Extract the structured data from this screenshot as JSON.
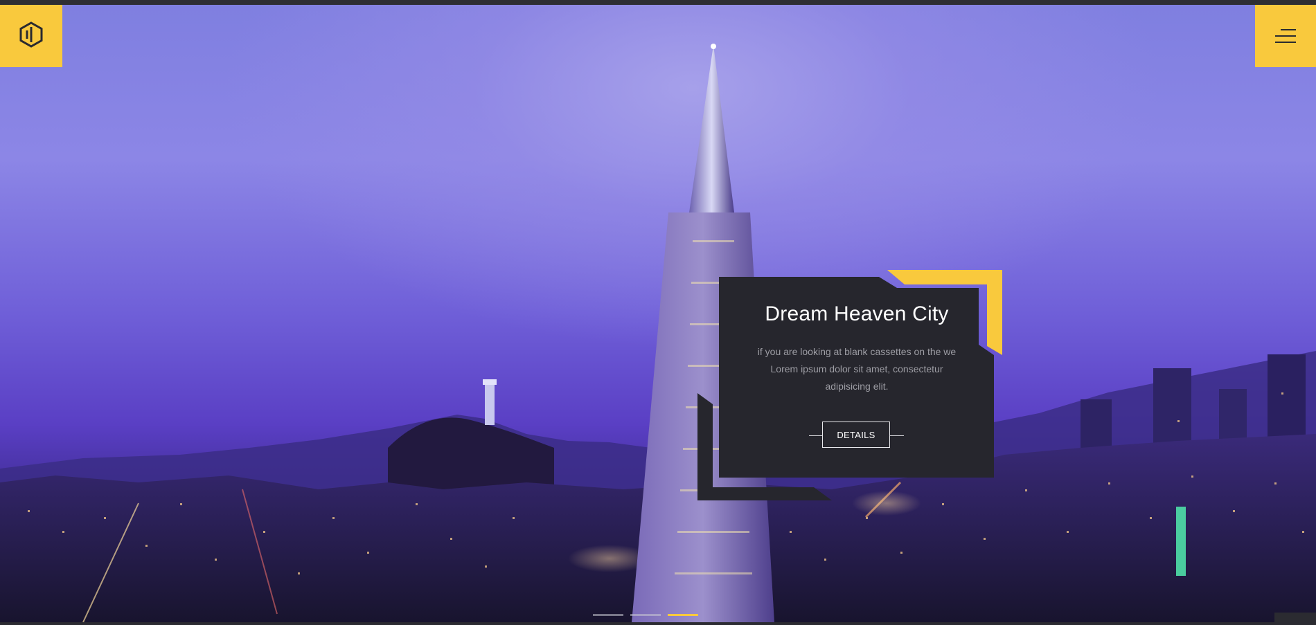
{
  "header": {
    "logo_icon": "hexagon-logo-icon",
    "menu_icon": "hamburger-menu-icon"
  },
  "slide": {
    "title": "Dream Heaven City",
    "text_lines": [
      "if you are looking at blank cassettes on the we",
      "Lorem ipsum dolor sit amet, consectetur",
      "adipisicing elit."
    ],
    "button_label": "DETAILS"
  },
  "slider": {
    "slide_count": 3,
    "active_index": 2
  },
  "colors": {
    "accent": "#f9c93d",
    "card": "#26262d",
    "text_muted": "#9d9da4"
  }
}
